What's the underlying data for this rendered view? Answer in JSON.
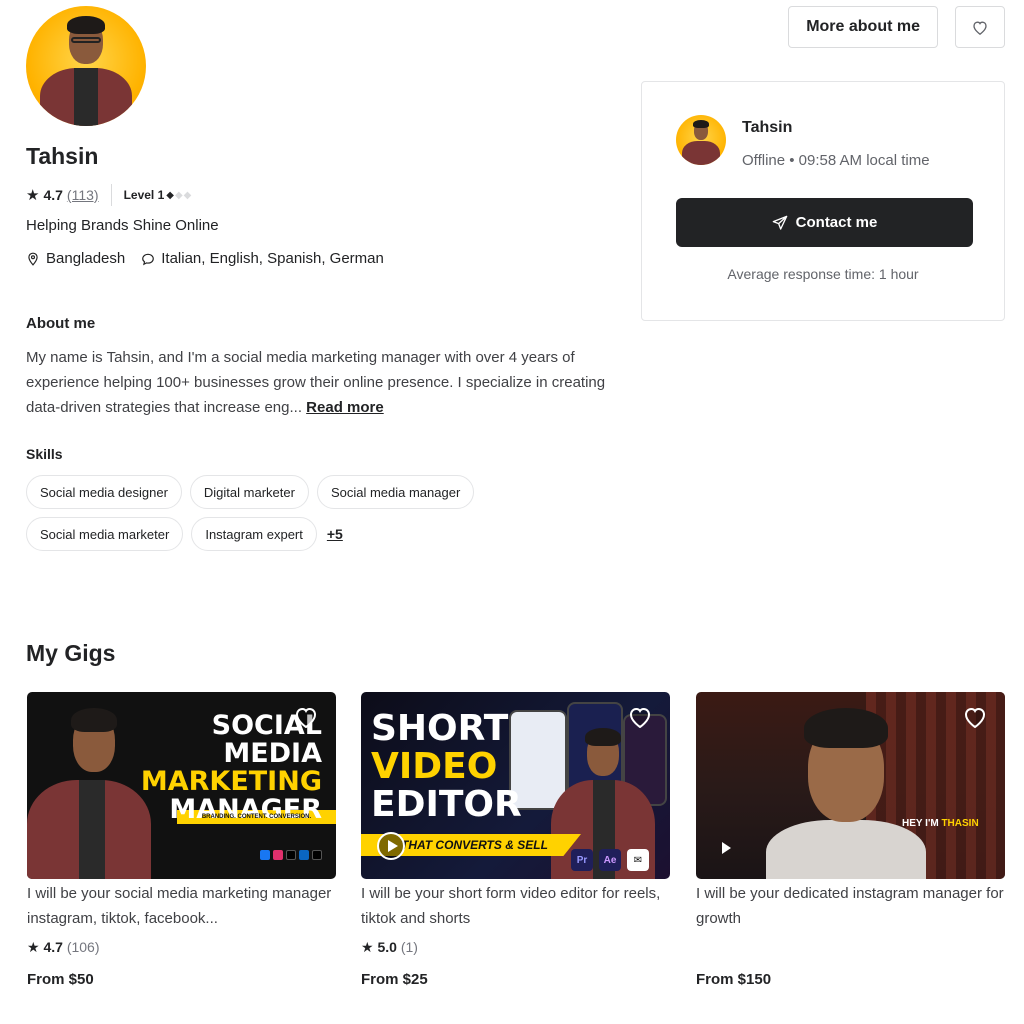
{
  "top_actions": {
    "more_about_label": "More about me"
  },
  "profile": {
    "name": "Tahsin",
    "rating": "4.7",
    "reviews": "(113)",
    "level": "Level 1",
    "tagline": "Helping Brands Shine Online",
    "country": "Bangladesh",
    "languages": "Italian, English, Spanish, German",
    "about_title": "About me",
    "about_text": "My name is Tahsin, and I'm a social media marketing manager with over 4 years of experience helping 100+ businesses grow their online presence. I specialize in creating data-driven strategies that increase eng... ",
    "read_more": "Read more",
    "skills_title": "Skills",
    "skills": [
      "Social media designer",
      "Digital marketer",
      "Social media manager",
      "Social media marketer",
      "Instagram expert"
    ],
    "skills_more": "+5"
  },
  "contact_card": {
    "name": "Tahsin",
    "status": "Offline • 09:58 AM local time",
    "button_label": "Contact me",
    "response": "Average response time: 1 hour"
  },
  "gigs": {
    "title": "My Gigs",
    "items": [
      {
        "title": "I will be your social media marketing manager instagram, tiktok, facebook...",
        "rating": "4.7",
        "reviews": "(106)",
        "price": "From $50",
        "thumb_lines": [
          "SOCIAL",
          "MEDIA",
          "MARKETING",
          "MANAGER"
        ],
        "thumb_strip": "BRANDING. CONTENT. CONVERSION."
      },
      {
        "title": "I will be your short form video editor for reels, tiktok and shorts",
        "rating": "5.0",
        "reviews": "(1)",
        "price": "From $25",
        "thumb_lines": [
          "SHORT",
          "VIDEO",
          "EDITOR"
        ],
        "thumb_band": "THAT CONVERTS & SELL",
        "app_icons": [
          "Pr",
          "Ae"
        ]
      },
      {
        "title": "I will be your dedicated instagram manager for growth",
        "rating": "",
        "reviews": "",
        "price": "From $150",
        "thumb_caption_white": "HEY I'M ",
        "thumb_caption_yellow": "THASIN"
      }
    ]
  },
  "colors": {
    "text": "#222325",
    "muted": "#74767e",
    "accent_yellow": "#ffd200",
    "button_dark": "#222325"
  },
  "icons": [
    "heart-icon",
    "star-icon",
    "location-pin-icon",
    "chat-bubble-icon",
    "send-icon",
    "play-icon"
  ]
}
